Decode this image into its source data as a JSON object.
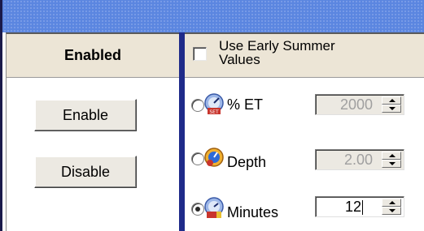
{
  "left": {
    "header": "Enabled",
    "enable_label": "Enable",
    "disable_label": "Disable"
  },
  "right": {
    "checkbox_label_line1": "Use Early Summer",
    "checkbox_label_line2": "Values",
    "checkbox_checked": false,
    "options": [
      {
        "label": "% ET",
        "value": "2000",
        "selected": false,
        "enabled": false,
        "icon": "et-gauge-icon"
      },
      {
        "label": "Depth",
        "value": "2.00",
        "selected": false,
        "enabled": false,
        "icon": "depth-gauge-icon"
      },
      {
        "label": "Minutes",
        "value": "12",
        "selected": true,
        "enabled": true,
        "icon": "minutes-gauge-icon"
      }
    ]
  },
  "colors": {
    "title_bar": "#5b86e0",
    "divider": "#1f2b8a",
    "header_bg": "#ece5d6"
  }
}
